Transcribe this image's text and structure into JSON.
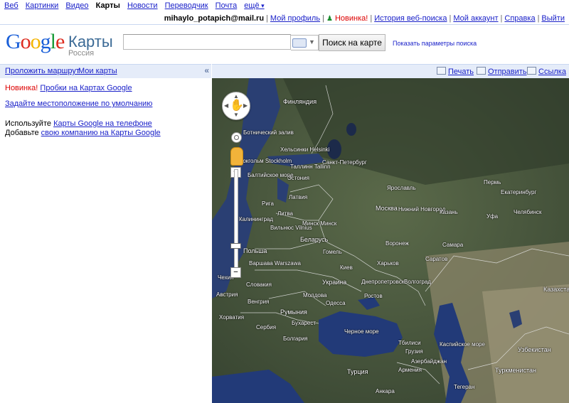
{
  "topnav": {
    "items": [
      "Веб",
      "Картинки",
      "Видео",
      "Карты",
      "Новости",
      "Переводчик",
      "Почта",
      "ещё"
    ]
  },
  "userbar": {
    "email": "mihaylo_potapich@mail.ru",
    "profile": "Мой профиль",
    "new": "Новинка!",
    "history": "История веб-поиска",
    "account": "Мой аккаунт",
    "help": "Справка",
    "logout": "Выйти"
  },
  "header": {
    "logo_text": "Google",
    "product": "Карты",
    "region": "Россия",
    "search_value": "",
    "search_button": "Поиск на карте",
    "search_options": "Показать параметры поиска"
  },
  "panel": {
    "directions": "Проложить маршрут",
    "my_maps": "Мои карты",
    "collapse": "«",
    "new_label": "Новинка!",
    "traffic_link": "Пробки на Картах Google",
    "default_location": "Задайте местоположение по умолчанию",
    "phone_prefix": "Используйте",
    "phone_link": "Карты Google на телефоне",
    "business_prefix": "Добавьте",
    "business_link": "свою компанию на Карты Google"
  },
  "map_toolbar": {
    "print": "Печать",
    "send": "Отправить",
    "link": "Ссылка"
  },
  "map_labels": [
    "Финляндия",
    "Ботнический залив",
    "Хельсинки Helsinki",
    "Санкт-Петербург",
    "Стокгольм Stockholm",
    "Таллинн Tallinn",
    "Балтийское море",
    "Эстония",
    "Латвия",
    "Рига",
    "Литва",
    "Москва",
    "Минск Минск",
    "Вильнюс Vilnius",
    "Калининград",
    "Беларусь",
    "Польша",
    "Варшава Warszawa",
    "Гомель",
    "Украина",
    "Киев",
    "Харьков",
    "Днепропетровск",
    "Молдова",
    "Одесса",
    "Румыния",
    "Бухарест",
    "Сербия",
    "Болгария",
    "Хорватия",
    "Австрия",
    "Венгрия",
    "Словакия",
    "Чехия",
    "Черное море",
    "Турция",
    "Анкара",
    "Грузия",
    "Азербайджан",
    "Армения",
    "Каспийское море",
    "Казахстан",
    "Узбекистан",
    "Туркменистан",
    "Самара",
    "Пермь",
    "Екатеринбург",
    "Нижний Новгород",
    "Казань",
    "Волгоград",
    "Ростов",
    "Тбилиси",
    "Ярославль",
    "Воронеж",
    "Саратов",
    "Уфа",
    "Челябинск",
    "Тегеран"
  ],
  "colors": {
    "link": "#1a21c9",
    "new_red": "#dd0000",
    "panel_bg": "#e5ecf9",
    "google_blue": "#1a5fd8",
    "google_red": "#dd2b1f",
    "google_yellow": "#f4b400",
    "google_green": "#1a9c3a"
  },
  "map_controls": {
    "zoom_in": "+",
    "zoom_out": "−",
    "zoom_level": 5
  }
}
